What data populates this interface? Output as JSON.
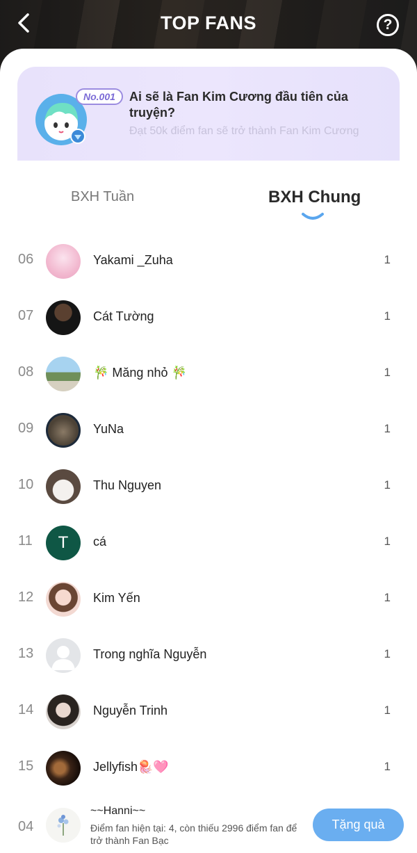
{
  "header": {
    "title": "TOP FANS"
  },
  "banner": {
    "badge": "No.001",
    "title": "Ai sẽ là Fan Kim Cương đầu tiên của truyện?",
    "subtitle": "Đạt 50k điểm fan sẽ trở thành Fan Kim Cương"
  },
  "tabs": {
    "week": "BXH Tuần",
    "all": "BXH Chung",
    "active": "BXH Chung"
  },
  "rows": [
    {
      "rank": "06",
      "name": "Yakami _Zuha",
      "score": "1"
    },
    {
      "rank": "07",
      "name": "Cát Tường",
      "score": "1"
    },
    {
      "rank": "08",
      "name": "🎋 Măng nhỏ 🎋",
      "score": "1"
    },
    {
      "rank": "09",
      "name": "YuNa",
      "score": "1"
    },
    {
      "rank": "10",
      "name": "Thu Nguyen",
      "score": "1"
    },
    {
      "rank": "11",
      "name": "cá",
      "score": "1",
      "initial": "T"
    },
    {
      "rank": "12",
      "name": "Kim Yến",
      "score": "1"
    },
    {
      "rank": "13",
      "name": "Trong nghĩa Nguyễn",
      "score": "1"
    },
    {
      "rank": "14",
      "name": "Nguyễn Trinh",
      "score": "1"
    },
    {
      "rank": "15",
      "name": "Jellyfish🪼🩷",
      "score": "1"
    }
  ],
  "footer": {
    "rank": "04",
    "name": "~~Hanni~~",
    "desc": "Điểm fan hiện tại: 4, còn thiếu 2996 điểm fan để trở thành Fan Bạc",
    "button": "Tặng quà"
  },
  "colors": {
    "accent": "#6aaef0",
    "banner_bg": "#e8e2fb",
    "badge": "#7b6bd6"
  }
}
